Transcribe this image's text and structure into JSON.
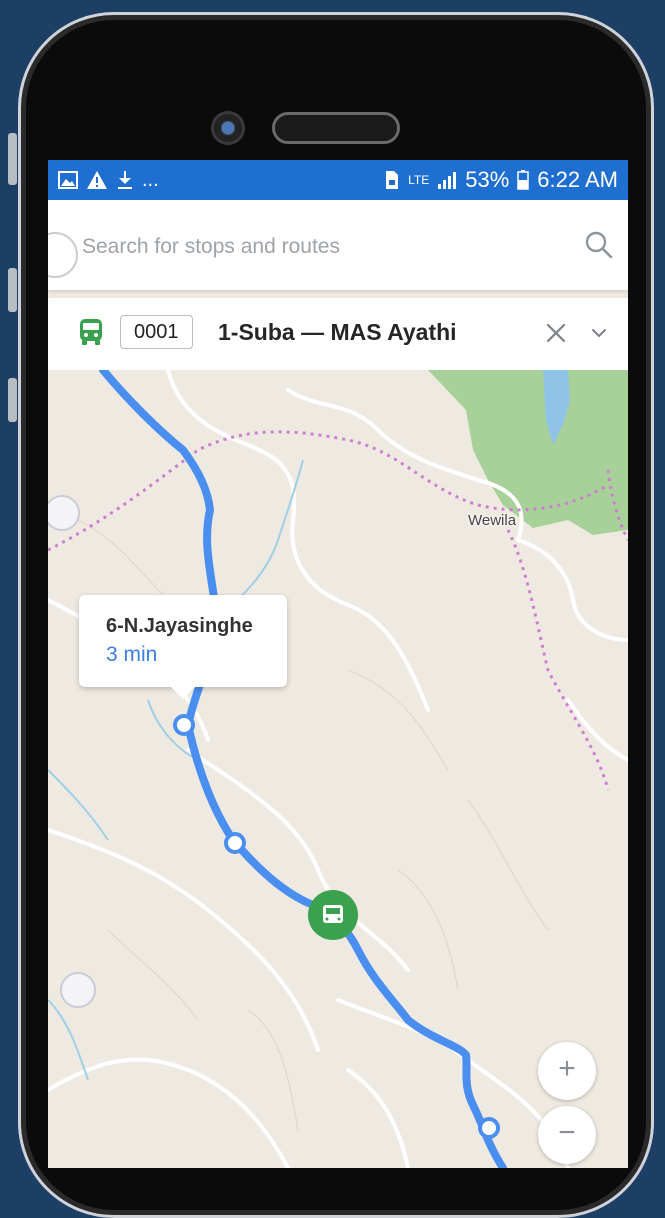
{
  "status_bar": {
    "left_icons": [
      "image-icon",
      "warning-icon",
      "download-icon"
    ],
    "left_more": "...",
    "network": "LTE",
    "battery": "53%",
    "time": "6:22 AM"
  },
  "search": {
    "placeholder": "Search for stops and routes"
  },
  "route": {
    "id": "0001",
    "name": "1-Suba — MAS Ayathi",
    "color": "#3aa24e"
  },
  "map": {
    "place_label": "Wewila",
    "route_color": "#4a8ff0",
    "popup": {
      "stop_name": "6-N.Jayasinghe",
      "eta": "3 min"
    }
  },
  "zoom": {
    "in_label": "+",
    "out_label": "−"
  }
}
